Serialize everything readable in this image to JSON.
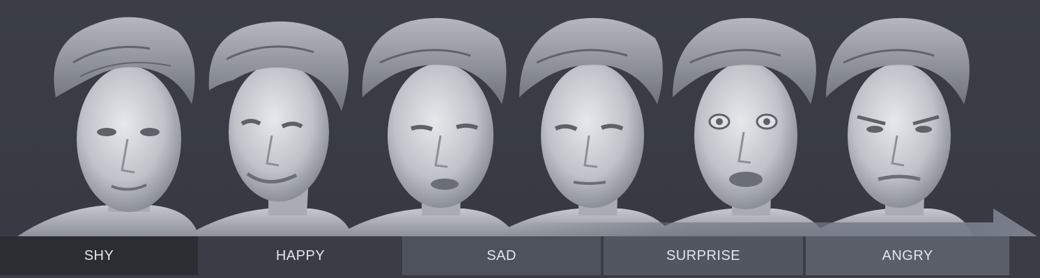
{
  "expressions": [
    {
      "label": "SHY",
      "active": true
    },
    {
      "label": "HAPPY",
      "active": false
    },
    {
      "label": "SAD",
      "active": false
    },
    {
      "label": "SURPRISE",
      "active": false
    },
    {
      "label": "ANGRY",
      "active": false
    }
  ],
  "colors": {
    "background": "#3a3d45",
    "active_segment": "#2b2d33",
    "segment": "#525661",
    "arrow": "#6b717e",
    "label_text": "#e3e5ea",
    "skin": "#c9ccd2",
    "hair": "#8e9299"
  }
}
